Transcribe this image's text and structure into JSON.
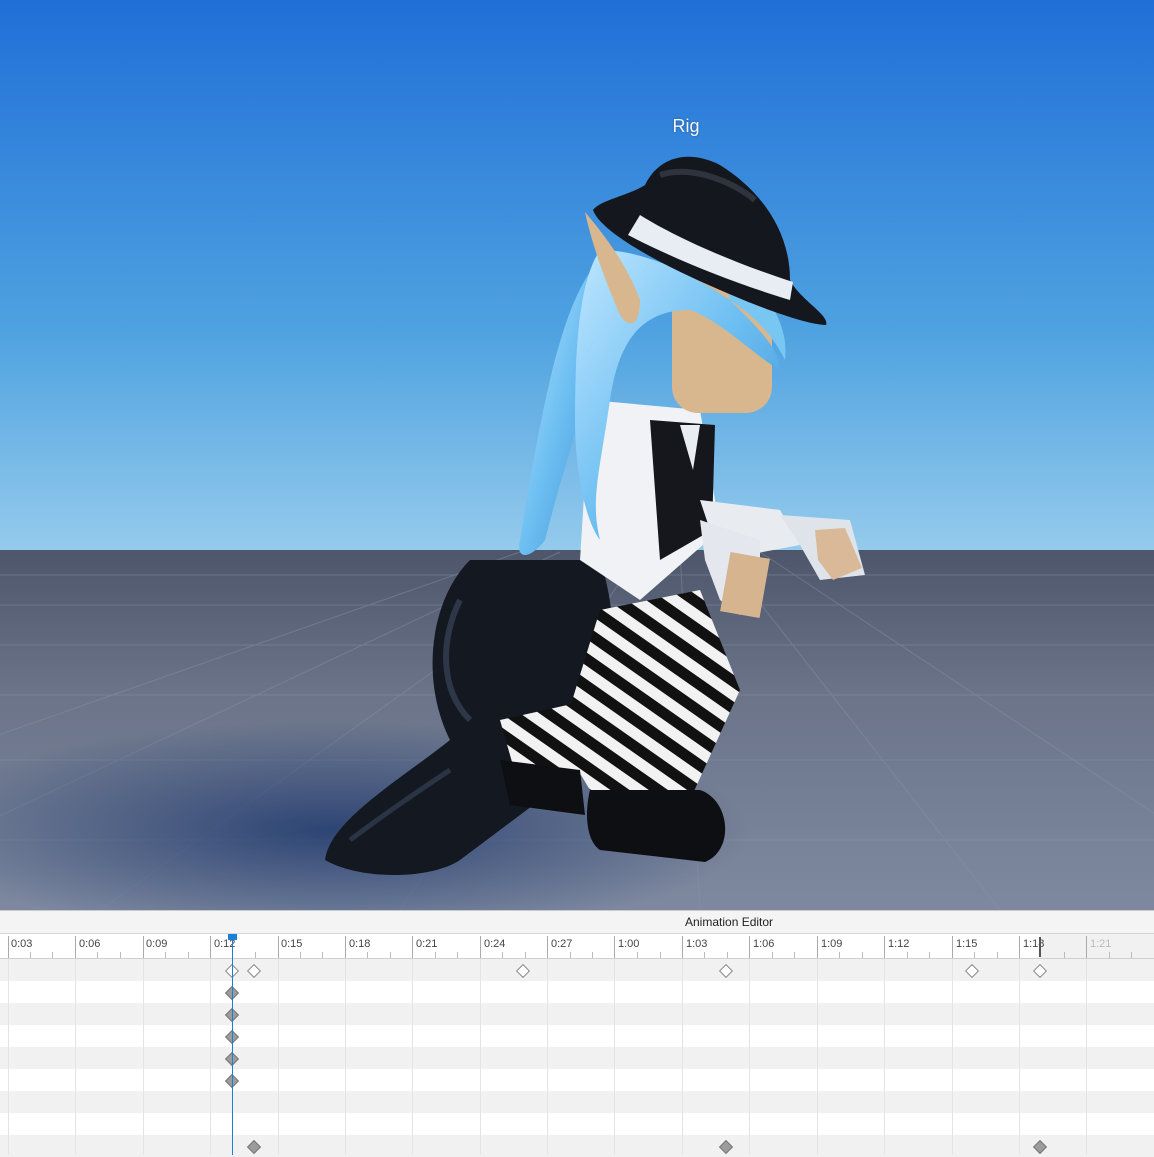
{
  "viewport": {
    "rig_label": "Rig"
  },
  "editor": {
    "title": "Animation Editor",
    "timeline_labels": [
      "0:03",
      "0:06",
      "0:09",
      "0:12",
      "0:15",
      "0:18",
      "0:21",
      "0:24",
      "0:27",
      "1:00",
      "1:03",
      "1:06",
      "1:09",
      "1:12",
      "1:15",
      "1:18",
      "1:21"
    ],
    "scrubber_time": "0:12"
  },
  "colors": {
    "sky_top": "#1f73d8",
    "sky_horizon": "#8fc8ec",
    "floor": "#69738a",
    "scrubber": "#1b7ed8"
  }
}
